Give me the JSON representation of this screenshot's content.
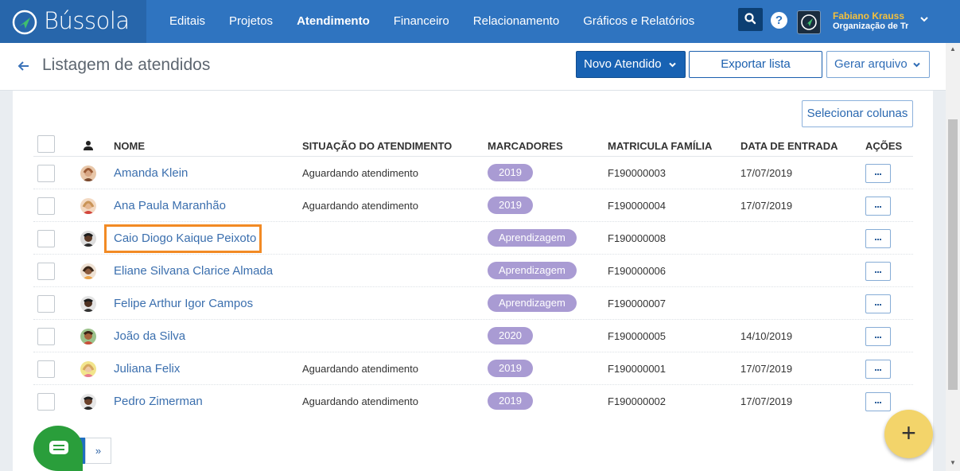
{
  "app": {
    "name": "Bússola"
  },
  "nav": {
    "items": [
      "Editais",
      "Projetos",
      "Atendimento",
      "Financeiro",
      "Relacionamento",
      "Gráficos e Relatórios"
    ],
    "active": "Atendimento"
  },
  "user": {
    "name": "Fabiano Krauss",
    "org": "Organização de Tre"
  },
  "page": {
    "title": "Listagem de atendidos"
  },
  "toolbar": {
    "novo_label": "Novo Atendido",
    "exportar_label": "Exportar lista",
    "gerar_label": "Gerar arquivo",
    "selecionar_label": "Selecionar colunas"
  },
  "table": {
    "headers": {
      "nome": "NOME",
      "situacao": "SITUAÇÃO DO ATENDIMENTO",
      "marcadores": "MARCADORES",
      "matricula": "MATRICULA FAMÍLIA",
      "data": "DATA DE ENTRADA",
      "acoes": "AÇÕES"
    },
    "rows": [
      {
        "name": "Amanda Klein",
        "status": "Aguardando atendimento",
        "tag": "2019",
        "matricula": "F190000003",
        "date": "17/07/2019"
      },
      {
        "name": "Ana Paula Maranhão",
        "status": "Aguardando atendimento",
        "tag": "2019",
        "matricula": "F190000004",
        "date": "17/07/2019"
      },
      {
        "name": "Caio Diogo Kaique Peixoto",
        "status": "",
        "tag": "Aprendizagem",
        "matricula": "F190000008",
        "date": ""
      },
      {
        "name": "Eliane Silvana Clarice Almada",
        "status": "",
        "tag": "Aprendizagem",
        "matricula": "F190000006",
        "date": ""
      },
      {
        "name": "Felipe Arthur Igor Campos",
        "status": "",
        "tag": "Aprendizagem",
        "matricula": "F190000007",
        "date": ""
      },
      {
        "name": "João da Silva",
        "status": "",
        "tag": "2020",
        "matricula": "F190000005",
        "date": "14/10/2019"
      },
      {
        "name": "Juliana Felix",
        "status": "Aguardando atendimento",
        "tag": "2019",
        "matricula": "F190000001",
        "date": "17/07/2019"
      },
      {
        "name": "Pedro Zimerman",
        "status": "Aguardando atendimento",
        "tag": "2019",
        "matricula": "F190000002",
        "date": "17/07/2019"
      }
    ]
  },
  "pagination": {
    "next_label": "»"
  },
  "fab": {
    "label": "+"
  },
  "colors": {
    "primary": "#2f74c0",
    "tag": "#a99bd3",
    "highlight": "#f28a24",
    "fab": "#f3d46a",
    "chat": "#2a9e3b",
    "link": "#3b6fae"
  }
}
